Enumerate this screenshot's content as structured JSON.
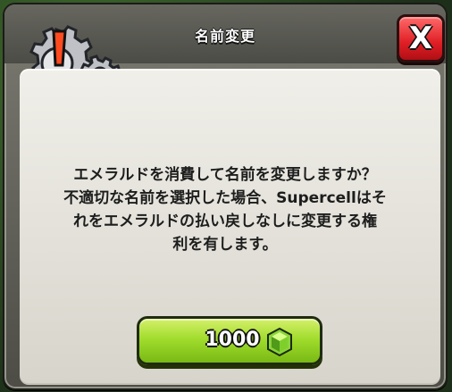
{
  "dialog": {
    "title": "名前変更",
    "message": "エメラルドを消費して名前を変更しますか？\n不適切な名前を選択した場合、Supercellはそ\nれをエメラルドの払い戻しなしに変更する権\n利を有します。",
    "close_label": "X",
    "price_label": "1000",
    "icons": {
      "settings_alert": "settings-alert-icon",
      "gem": "gem-icon"
    },
    "colors": {
      "close_button": "#df1f25",
      "price_button": "#9fdb2b",
      "panel": "#e8e6df"
    }
  }
}
